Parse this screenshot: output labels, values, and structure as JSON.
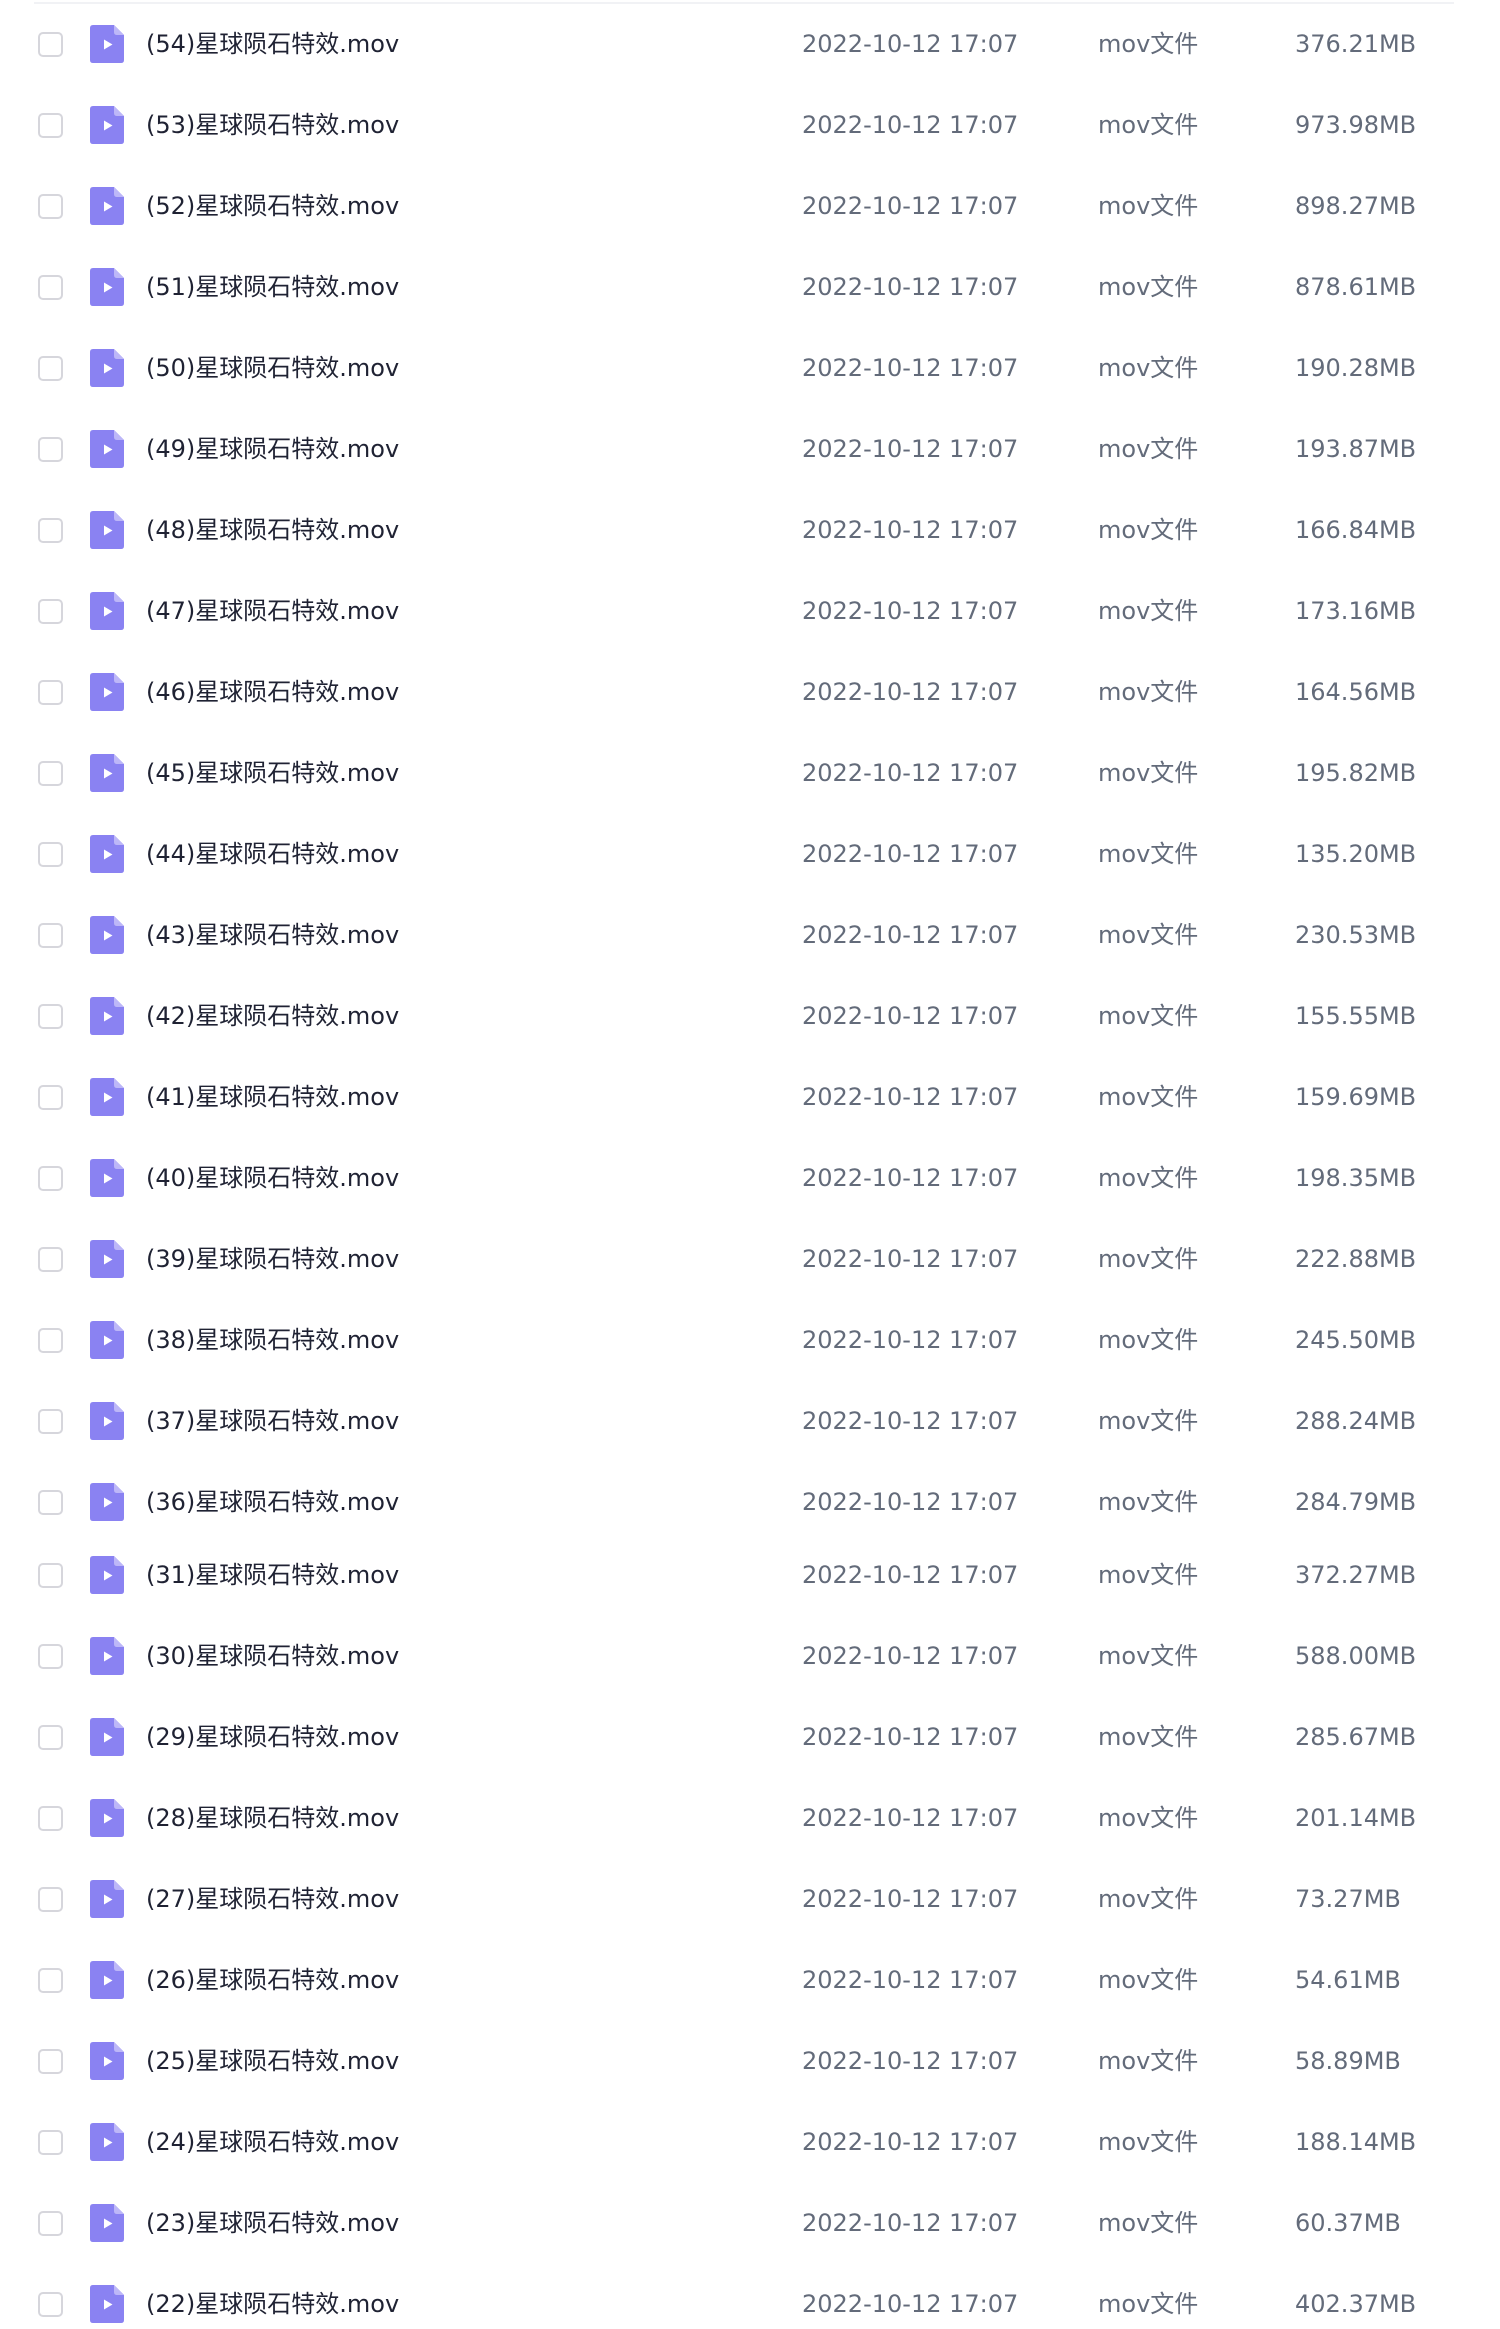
{
  "file_list": {
    "files": [
      {
        "name": "(54)星球陨石特效.mov",
        "date": "2022-10-12 17:07",
        "type": "mov文件",
        "size": "376.21MB"
      },
      {
        "name": "(53)星球陨石特效.mov",
        "date": "2022-10-12 17:07",
        "type": "mov文件",
        "size": "973.98MB"
      },
      {
        "name": "(52)星球陨石特效.mov",
        "date": "2022-10-12 17:07",
        "type": "mov文件",
        "size": "898.27MB"
      },
      {
        "name": "(51)星球陨石特效.mov",
        "date": "2022-10-12 17:07",
        "type": "mov文件",
        "size": "878.61MB"
      },
      {
        "name": "(50)星球陨石特效.mov",
        "date": "2022-10-12 17:07",
        "type": "mov文件",
        "size": "190.28MB"
      },
      {
        "name": "(49)星球陨石特效.mov",
        "date": "2022-10-12 17:07",
        "type": "mov文件",
        "size": "193.87MB"
      },
      {
        "name": "(48)星球陨石特效.mov",
        "date": "2022-10-12 17:07",
        "type": "mov文件",
        "size": "166.84MB"
      },
      {
        "name": "(47)星球陨石特效.mov",
        "date": "2022-10-12 17:07",
        "type": "mov文件",
        "size": "173.16MB"
      },
      {
        "name": "(46)星球陨石特效.mov",
        "date": "2022-10-12 17:07",
        "type": "mov文件",
        "size": "164.56MB"
      },
      {
        "name": "(45)星球陨石特效.mov",
        "date": "2022-10-12 17:07",
        "type": "mov文件",
        "size": "195.82MB"
      },
      {
        "name": "(44)星球陨石特效.mov",
        "date": "2022-10-12 17:07",
        "type": "mov文件",
        "size": "135.20MB"
      },
      {
        "name": "(43)星球陨石特效.mov",
        "date": "2022-10-12 17:07",
        "type": "mov文件",
        "size": "230.53MB"
      },
      {
        "name": "(42)星球陨石特效.mov",
        "date": "2022-10-12 17:07",
        "type": "mov文件",
        "size": "155.55MB"
      },
      {
        "name": "(41)星球陨石特效.mov",
        "date": "2022-10-12 17:07",
        "type": "mov文件",
        "size": "159.69MB"
      },
      {
        "name": "(40)星球陨石特效.mov",
        "date": "2022-10-12 17:07",
        "type": "mov文件",
        "size": "198.35MB"
      },
      {
        "name": "(39)星球陨石特效.mov",
        "date": "2022-10-12 17:07",
        "type": "mov文件",
        "size": "222.88MB"
      },
      {
        "name": "(38)星球陨石特效.mov",
        "date": "2022-10-12 17:07",
        "type": "mov文件",
        "size": "245.50MB"
      },
      {
        "name": "(37)星球陨石特效.mov",
        "date": "2022-10-12 17:07",
        "type": "mov文件",
        "size": "288.24MB"
      },
      {
        "name": "(36)星球陨石特效.mov",
        "date": "2022-10-12 17:07",
        "type": "mov文件",
        "size": "284.79MB"
      },
      {
        "name": "(31)星球陨石特效.mov",
        "date": "2022-10-12 17:07",
        "type": "mov文件",
        "size": "372.27MB"
      },
      {
        "name": "(30)星球陨石特效.mov",
        "date": "2022-10-12 17:07",
        "type": "mov文件",
        "size": "588.00MB"
      },
      {
        "name": "(29)星球陨石特效.mov",
        "date": "2022-10-12 17:07",
        "type": "mov文件",
        "size": "285.67MB"
      },
      {
        "name": "(28)星球陨石特效.mov",
        "date": "2022-10-12 17:07",
        "type": "mov文件",
        "size": "201.14MB"
      },
      {
        "name": "(27)星球陨石特效.mov",
        "date": "2022-10-12 17:07",
        "type": "mov文件",
        "size": "73.27MB"
      },
      {
        "name": "(26)星球陨石特效.mov",
        "date": "2022-10-12 17:07",
        "type": "mov文件",
        "size": "54.61MB"
      },
      {
        "name": "(25)星球陨石特效.mov",
        "date": "2022-10-12 17:07",
        "type": "mov文件",
        "size": "58.89MB"
      },
      {
        "name": "(24)星球陨石特效.mov",
        "date": "2022-10-12 17:07",
        "type": "mov文件",
        "size": "188.14MB"
      },
      {
        "name": "(23)星球陨石特效.mov",
        "date": "2022-10-12 17:07",
        "type": "mov文件",
        "size": "60.37MB"
      },
      {
        "name": "(22)星球陨石特效.mov",
        "date": "2022-10-12 17:07",
        "type": "mov文件",
        "size": "402.37MB"
      }
    ],
    "file_icon_name": "video-file-icon",
    "colors": {
      "icon_body": "#8a82f2",
      "icon_fold": "#bdb7f8",
      "name_text": "#1f2233",
      "meta_text": "#636b7a",
      "checkbox_border": "#d6d6dc"
    }
  }
}
